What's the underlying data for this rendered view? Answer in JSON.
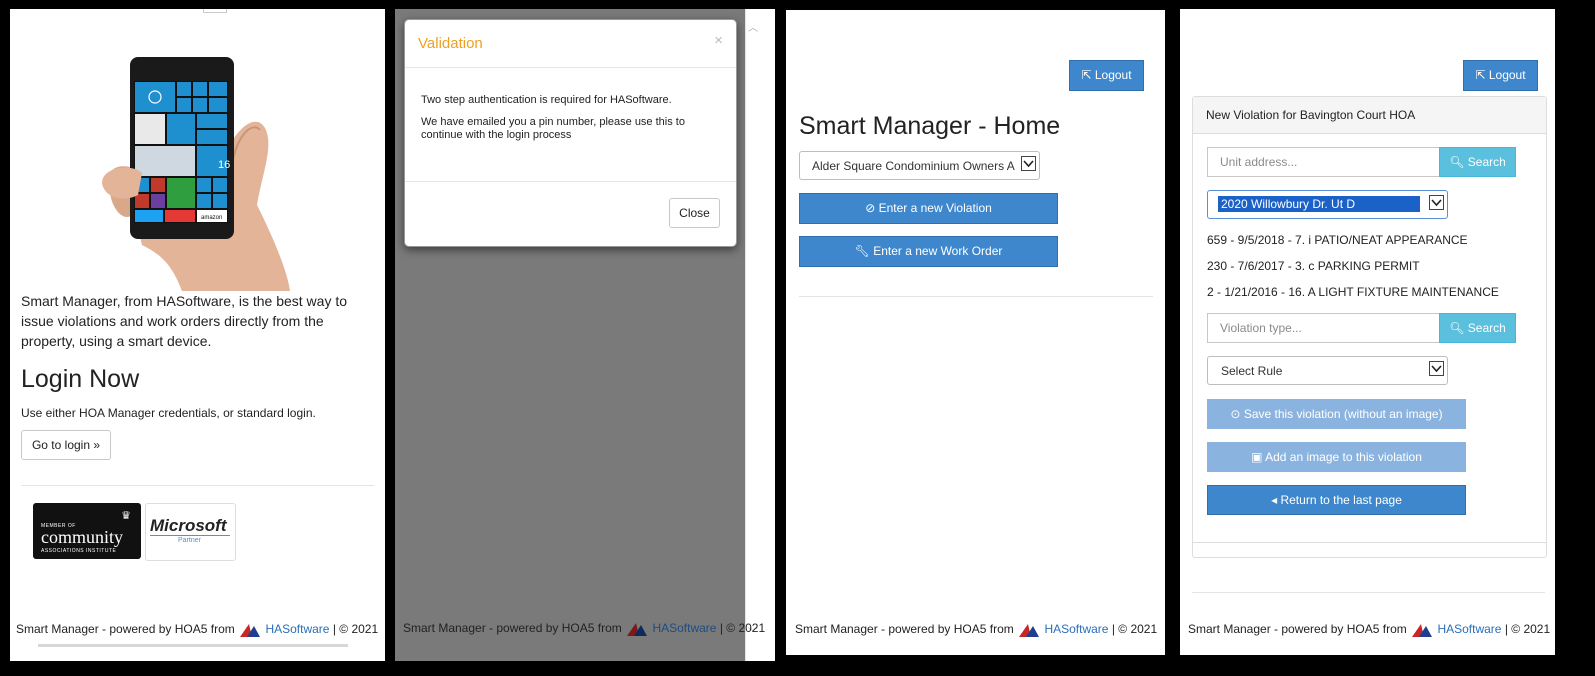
{
  "footer": {
    "prefix": "Smart Manager - powered by HOA5 from",
    "company": "HASoftware",
    "suffix": "| © 2021"
  },
  "panel1": {
    "intro": "Smart Manager, from HASoftware, is the best way to issue violations and work orders directly from the property, using a smart device.",
    "login_heading": "Login Now",
    "login_hint": "Use either HOA Manager credentials, or standard login.",
    "login_button": "Go to login »",
    "cai_badge": {
      "line1": "MEMBER OF",
      "line2": "community",
      "line3": "ASSOCIATIONS INSTITUTE"
    },
    "ms_badge": {
      "line1": "Microsoft",
      "line2": "Partner"
    },
    "phone_tiles": {
      "date_number": "16",
      "amazon": "amazon"
    }
  },
  "panel2": {
    "modal_title": "Validation",
    "close_x": "×",
    "message1": "Two step authentication is required for HASoftware.",
    "message2": "We have emailed you a pin number, please use this to continue with the login process",
    "close_button": "Close"
  },
  "panel3": {
    "logout": "Logout",
    "title": "Smart Manager - Home",
    "association_select": "Alder Square Condominium Owners A",
    "violation_button": "Enter a new Violation",
    "work_order_button": "Enter a new Work Order"
  },
  "panel4": {
    "logout": "Logout",
    "card_title": "New Violation for Bavington Court HOA",
    "unit_placeholder": "Unit address...",
    "search_label": "Search",
    "unit_select": "2020 Willowbury Dr. Ut D",
    "history": [
      "659 - 9/5/2018 - 7. i PATIO/NEAT APPEARANCE",
      "230 - 7/6/2017 - 3. c PARKING PERMIT",
      "2 - 1/21/2016 - 16. A LIGHT FIXTURE MAINTENANCE"
    ],
    "violation_placeholder": "Violation type...",
    "rule_select": "Select Rule",
    "save_button": "Save this violation (without an image)",
    "image_button": "Add an image to this violation",
    "return_button": "Return to the last page"
  },
  "colors": {
    "primary": "#3f87cc",
    "primary_disabled": "#8ab4df",
    "info": "#5bc0de",
    "modal_title": "#f0a020",
    "backdrop": "#7a7a7a"
  }
}
